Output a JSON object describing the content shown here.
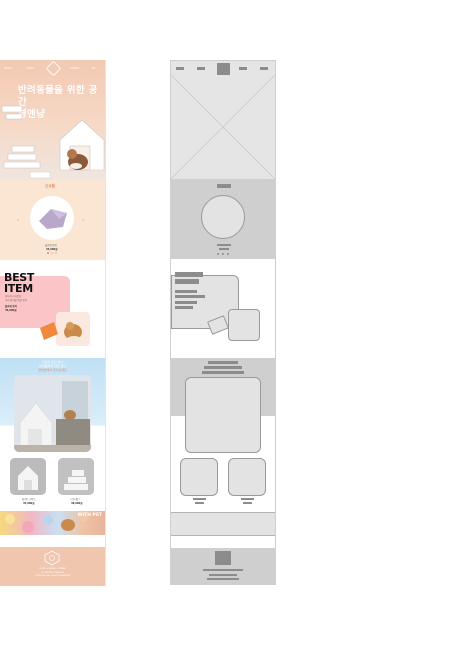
{
  "design": {
    "nav": [
      "MENU",
      "SHOP",
      "",
      "EVENT",
      "MY"
    ],
    "hero_title_line1": "반려동물을 위한 공간",
    "hero_title_line2": "영앤냥",
    "new_section_title": "신상품",
    "new_product_name": "플라워 방석",
    "new_product_price": "35,000원",
    "best_title_line1": "BEST",
    "best_title_line2": "ITEM",
    "best_desc_line1": "아늑하고 따뜻한",
    "best_desc_line2": "우리 아이를 위한 방석",
    "best_product_name": "플라워 방석",
    "best_product_price": "35,000원",
    "feature_line1": "나만의 공간 하나",
    "feature_line2": "반려동물을 위한 공간",
    "feature_sub": "영앤냥에서 만나보세요",
    "thumb1_name": "화이트 하우스",
    "thumb1_price": "45,000원",
    "thumb2_name": "스텝 계단",
    "thumb2_price": "38,000원",
    "banner_text": "WITH PET",
    "footer_line1": "YOUNG & NYANG  COMPANY",
    "footer_line2": "CS CENTER 1234-5678",
    "footer_line3": "COPYRIGHT ALL RIGHTS RESERVED"
  },
  "colors": {
    "hero": "#f3c9b2",
    "new_section": "#fbe6d4",
    "pink_card": "#fbc4c6",
    "feature_sky": "#bfe0f4",
    "footer": "#f1c6ae",
    "accent_orange": "#f08a5d"
  }
}
